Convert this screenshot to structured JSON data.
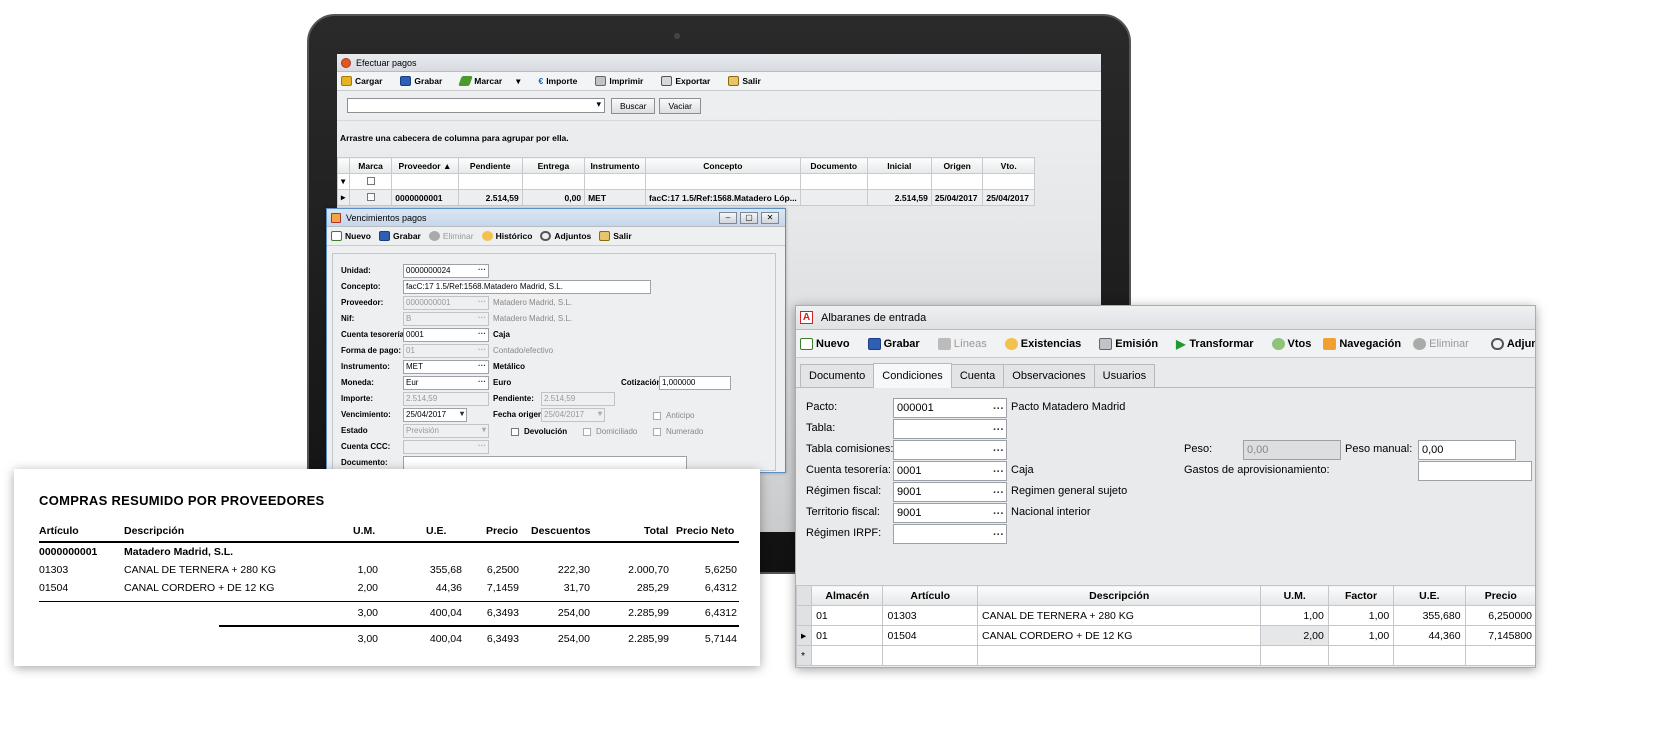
{
  "efectuar": {
    "title": "Efectuar pagos",
    "toolbar": [
      "Cargar",
      "Grabar",
      "Marcar",
      "Importe",
      "Imprimir",
      "Exportar",
      "Salir"
    ],
    "search_button": "Buscar",
    "clear_button": "Vaciar",
    "group_hint": "Arrastre una cabecera de columna para agrupar por ella.",
    "columns": [
      "Marca",
      "Proveedor",
      "Pendiente",
      "Entrega",
      "Instrumento",
      "Concepto",
      "Documento",
      "Inicial",
      "Origen",
      "Vto."
    ],
    "row": {
      "proveedor": "0000000001",
      "pendiente": "2.514,59",
      "entrega": "0,00",
      "instrumento": "MET",
      "concepto": "facC:17 1.5/Ref:1568.Matadero Lóp...",
      "inicial": "2.514,59",
      "origen": "25/04/2017",
      "vto": "25/04/2017"
    }
  },
  "venc": {
    "title": "Vencimientos pagos",
    "toolbar": [
      "Nuevo",
      "Grabar",
      "Eliminar",
      "Histórico",
      "Adjuntos",
      "Salir"
    ],
    "labels": {
      "unidad": "Unidad:",
      "concepto": "Concepto:",
      "proveedor": "Proveedor:",
      "nif": "Nif:",
      "cuenta": "Cuenta tesorería:",
      "forma": "Forma de pago:",
      "instrumento": "Instrumento:",
      "moneda": "Moneda:",
      "cotizacion": "Cotización:",
      "importe": "Importe:",
      "pendiente": "Pendiente:",
      "vencimiento": "Vencimiento:",
      "fecha_origen": "Fecha origen:",
      "anticipo": "Anticipo",
      "estado": "Estado",
      "devolucion": "Devolución",
      "domiciliado": "Domiciliado",
      "numerado": "Numerado",
      "cuenta_ccc": "Cuenta CCC:",
      "documento": "Documento:"
    },
    "values": {
      "unidad": "0000000024",
      "concepto": "facC:17 1.5/Ref:1568.Matadero  Madrid, S.L.",
      "proveedor": "0000000001",
      "proveedor_name": "Matadero Madrid, S.L.",
      "nif": "B",
      "nif_name": "Matadero Madrid, S.L.",
      "cuenta": "0001",
      "cuenta_name": "Caja",
      "forma": "01",
      "forma_name": "Contado/efectivo",
      "instrumento": "MET",
      "instrumento_name": "Metálico",
      "moneda": "Eur",
      "moneda_name": "Euro",
      "cotizacion": "1,000000",
      "importe": "2.514,59",
      "pendiente": "2.514,59",
      "vencimiento": "25/04/2017",
      "fecha_origen": "25/04/2017",
      "estado": "Previsión"
    }
  },
  "report": {
    "title": "COMPRAS RESUMIDO POR PROVEEDORES",
    "headers": [
      "Artículo",
      "Descripción",
      "U.M.",
      "U.E.",
      "Precio",
      "Descuentos",
      "Total",
      "Precio Neto"
    ],
    "group_code": "0000000001",
    "group_name": "Matadero Madrid, S.L.",
    "rows": [
      [
        "01303",
        "CANAL DE TERNERA + 280 KG",
        "1,00",
        "355,68",
        "6,2500",
        "222,30",
        "2.000,70",
        "5,6250"
      ],
      [
        "01504",
        "CANAL CORDERO + DE 12 KG",
        "2,00",
        "44,36",
        "7,1459",
        "31,70",
        "285,29",
        "6,4312"
      ]
    ],
    "subtotal": [
      "3,00",
      "400,04",
      "6,3493",
      "254,00",
      "2.285,99",
      "6,4312"
    ],
    "total": [
      "3,00",
      "400,04",
      "6,3493",
      "254,00",
      "2.285,99",
      "5,7144"
    ]
  },
  "alb": {
    "title": "Albaranes de entrada",
    "toolbar": [
      "Nuevo",
      "Grabar",
      "Líneas",
      "Existencias",
      "Emisión",
      "Transformar",
      "Vtos",
      "Navegación",
      "Eliminar",
      "Adjuntos"
    ],
    "tabs": [
      "Documento",
      "Condiciones",
      "Cuenta",
      "Observaciones",
      "Usuarios"
    ],
    "labels": {
      "pacto": "Pacto:",
      "tabla": "Tabla:",
      "comisiones": "Tabla comisiones:",
      "cuenta": "Cuenta tesorería:",
      "regimen": "Régimen fiscal:",
      "territorio": "Territorio fiscal:",
      "irpf": "Régimen IRPF:",
      "peso": "Peso:",
      "peso_manual": "Peso manual:",
      "gastos": "Gastos de aprovisionamiento:"
    },
    "values": {
      "pacto": "000001",
      "pacto_name": "Pacto Matadero Madrid",
      "cuenta": "0001",
      "cuenta_name": "Caja",
      "regimen": "9001",
      "regimen_name": "Regimen general sujeto",
      "territorio": "9001",
      "territorio_name": "Nacional interior",
      "peso": "0,00",
      "peso_manual": "0,00"
    },
    "columns": [
      "Almacén",
      "Artículo",
      "Descripción",
      "U.M.",
      "Factor",
      "U.E.",
      "Precio"
    ],
    "rows": [
      [
        "01",
        "01303",
        "CANAL DE TERNERA + 280 KG",
        "1,00",
        "1,00",
        "355,680",
        "6,250000"
      ],
      [
        "01",
        "01504",
        "CANAL CORDERO + DE 12 KG",
        "2,00",
        "1,00",
        "44,360",
        "7,145800"
      ]
    ]
  }
}
